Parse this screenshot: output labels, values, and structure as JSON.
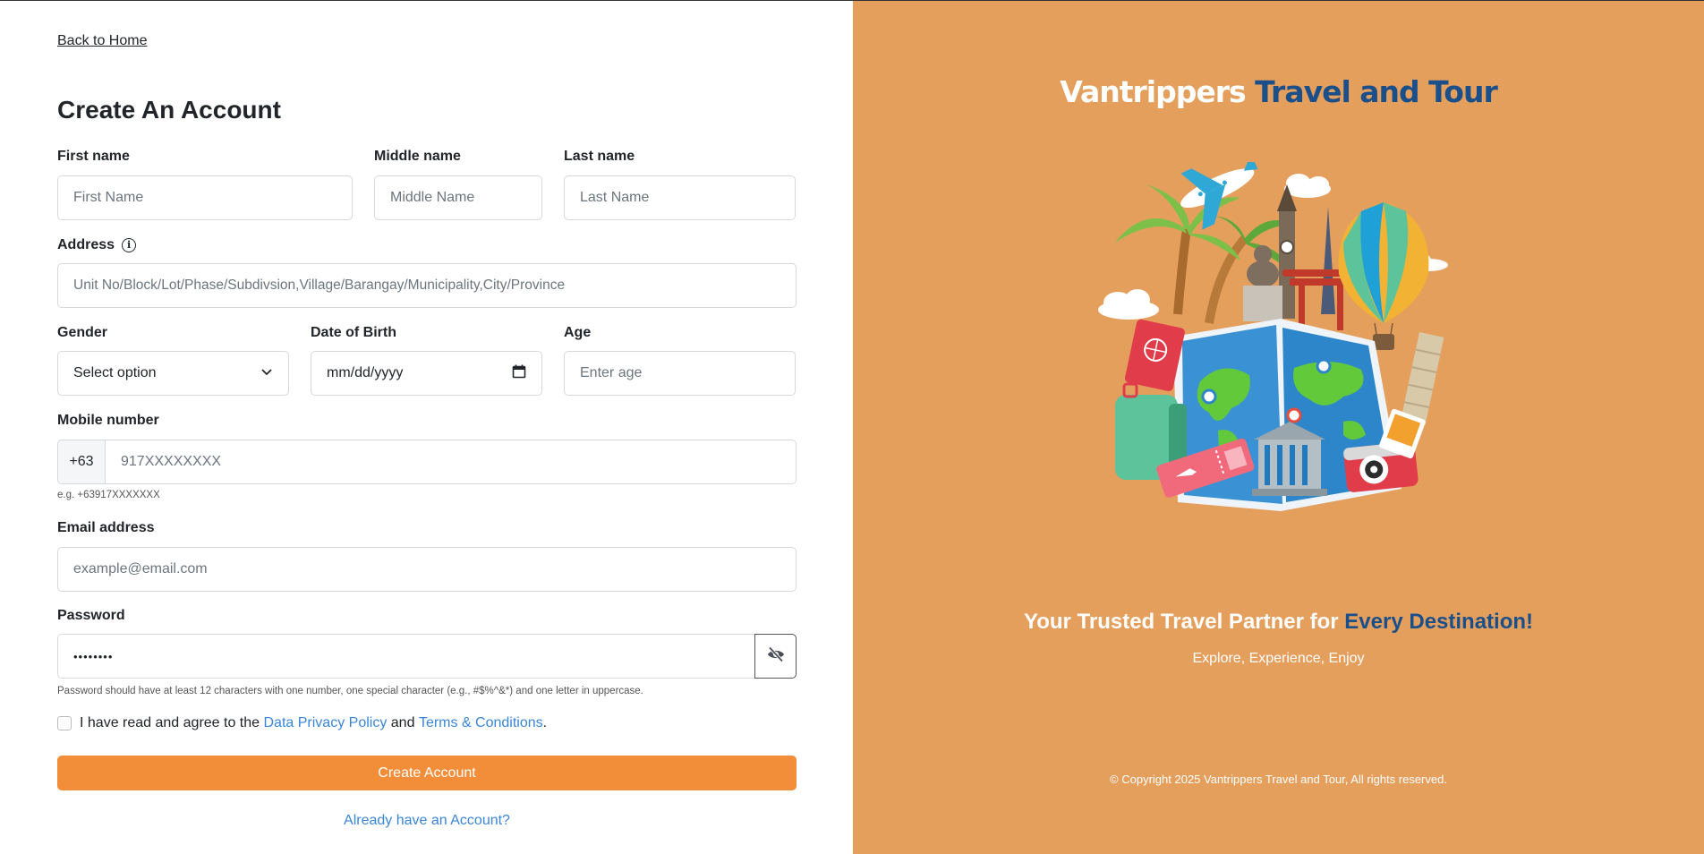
{
  "nav": {
    "back_label": "Back to Home"
  },
  "form": {
    "title": "Create An Account",
    "first_name": {
      "label": "First name",
      "placeholder": "First Name"
    },
    "middle_name": {
      "label": "Middle name",
      "placeholder": "Middle Name"
    },
    "last_name": {
      "label": "Last name",
      "placeholder": "Last Name"
    },
    "address": {
      "label": "Address",
      "placeholder": "Unit No/Block/Lot/Phase/Subdivsion,Village/Barangay/Municipality,City/Province"
    },
    "gender": {
      "label": "Gender",
      "value": "Select option"
    },
    "dob": {
      "label": "Date of Birth",
      "value": "mm/dd/yyyy"
    },
    "age": {
      "label": "Age",
      "placeholder": "Enter age"
    },
    "mobile": {
      "label": "Mobile number",
      "prefix": "+63",
      "placeholder": "917XXXXXXXX",
      "hint": "e.g. +63917XXXXXXX"
    },
    "email": {
      "label": "Email address",
      "placeholder": "example@email.com"
    },
    "password": {
      "label": "Password",
      "value": "••••••••",
      "hint": "Password should have at least 12 characters with one number, one special character (e.g., #$%^&*) and one letter in uppercase."
    },
    "agree": {
      "prefix": "I have read and agree to the",
      "privacy_link": "Data Privacy Policy",
      "and": "and",
      "terms_link": "Terms & Conditions",
      "suffix": "."
    },
    "submit_label": "Create Account",
    "login_link": "Already have an Account?"
  },
  "promo": {
    "brand_white": "Vantrippers",
    "brand_blue": "Travel and Tour",
    "tagline_white": "Your Trusted Travel Partner for",
    "tagline_blue": "Every Destination!",
    "subtitle": "Explore, Experience, Enjoy",
    "copyright": "© Copyright 2025 Vantrippers Travel and Tour, All rights reserved."
  },
  "colors": {
    "panel": "#E59F5D",
    "button": "#F28D3A",
    "link": "#3a86d6",
    "brand_blue": "#1b4f8a"
  }
}
